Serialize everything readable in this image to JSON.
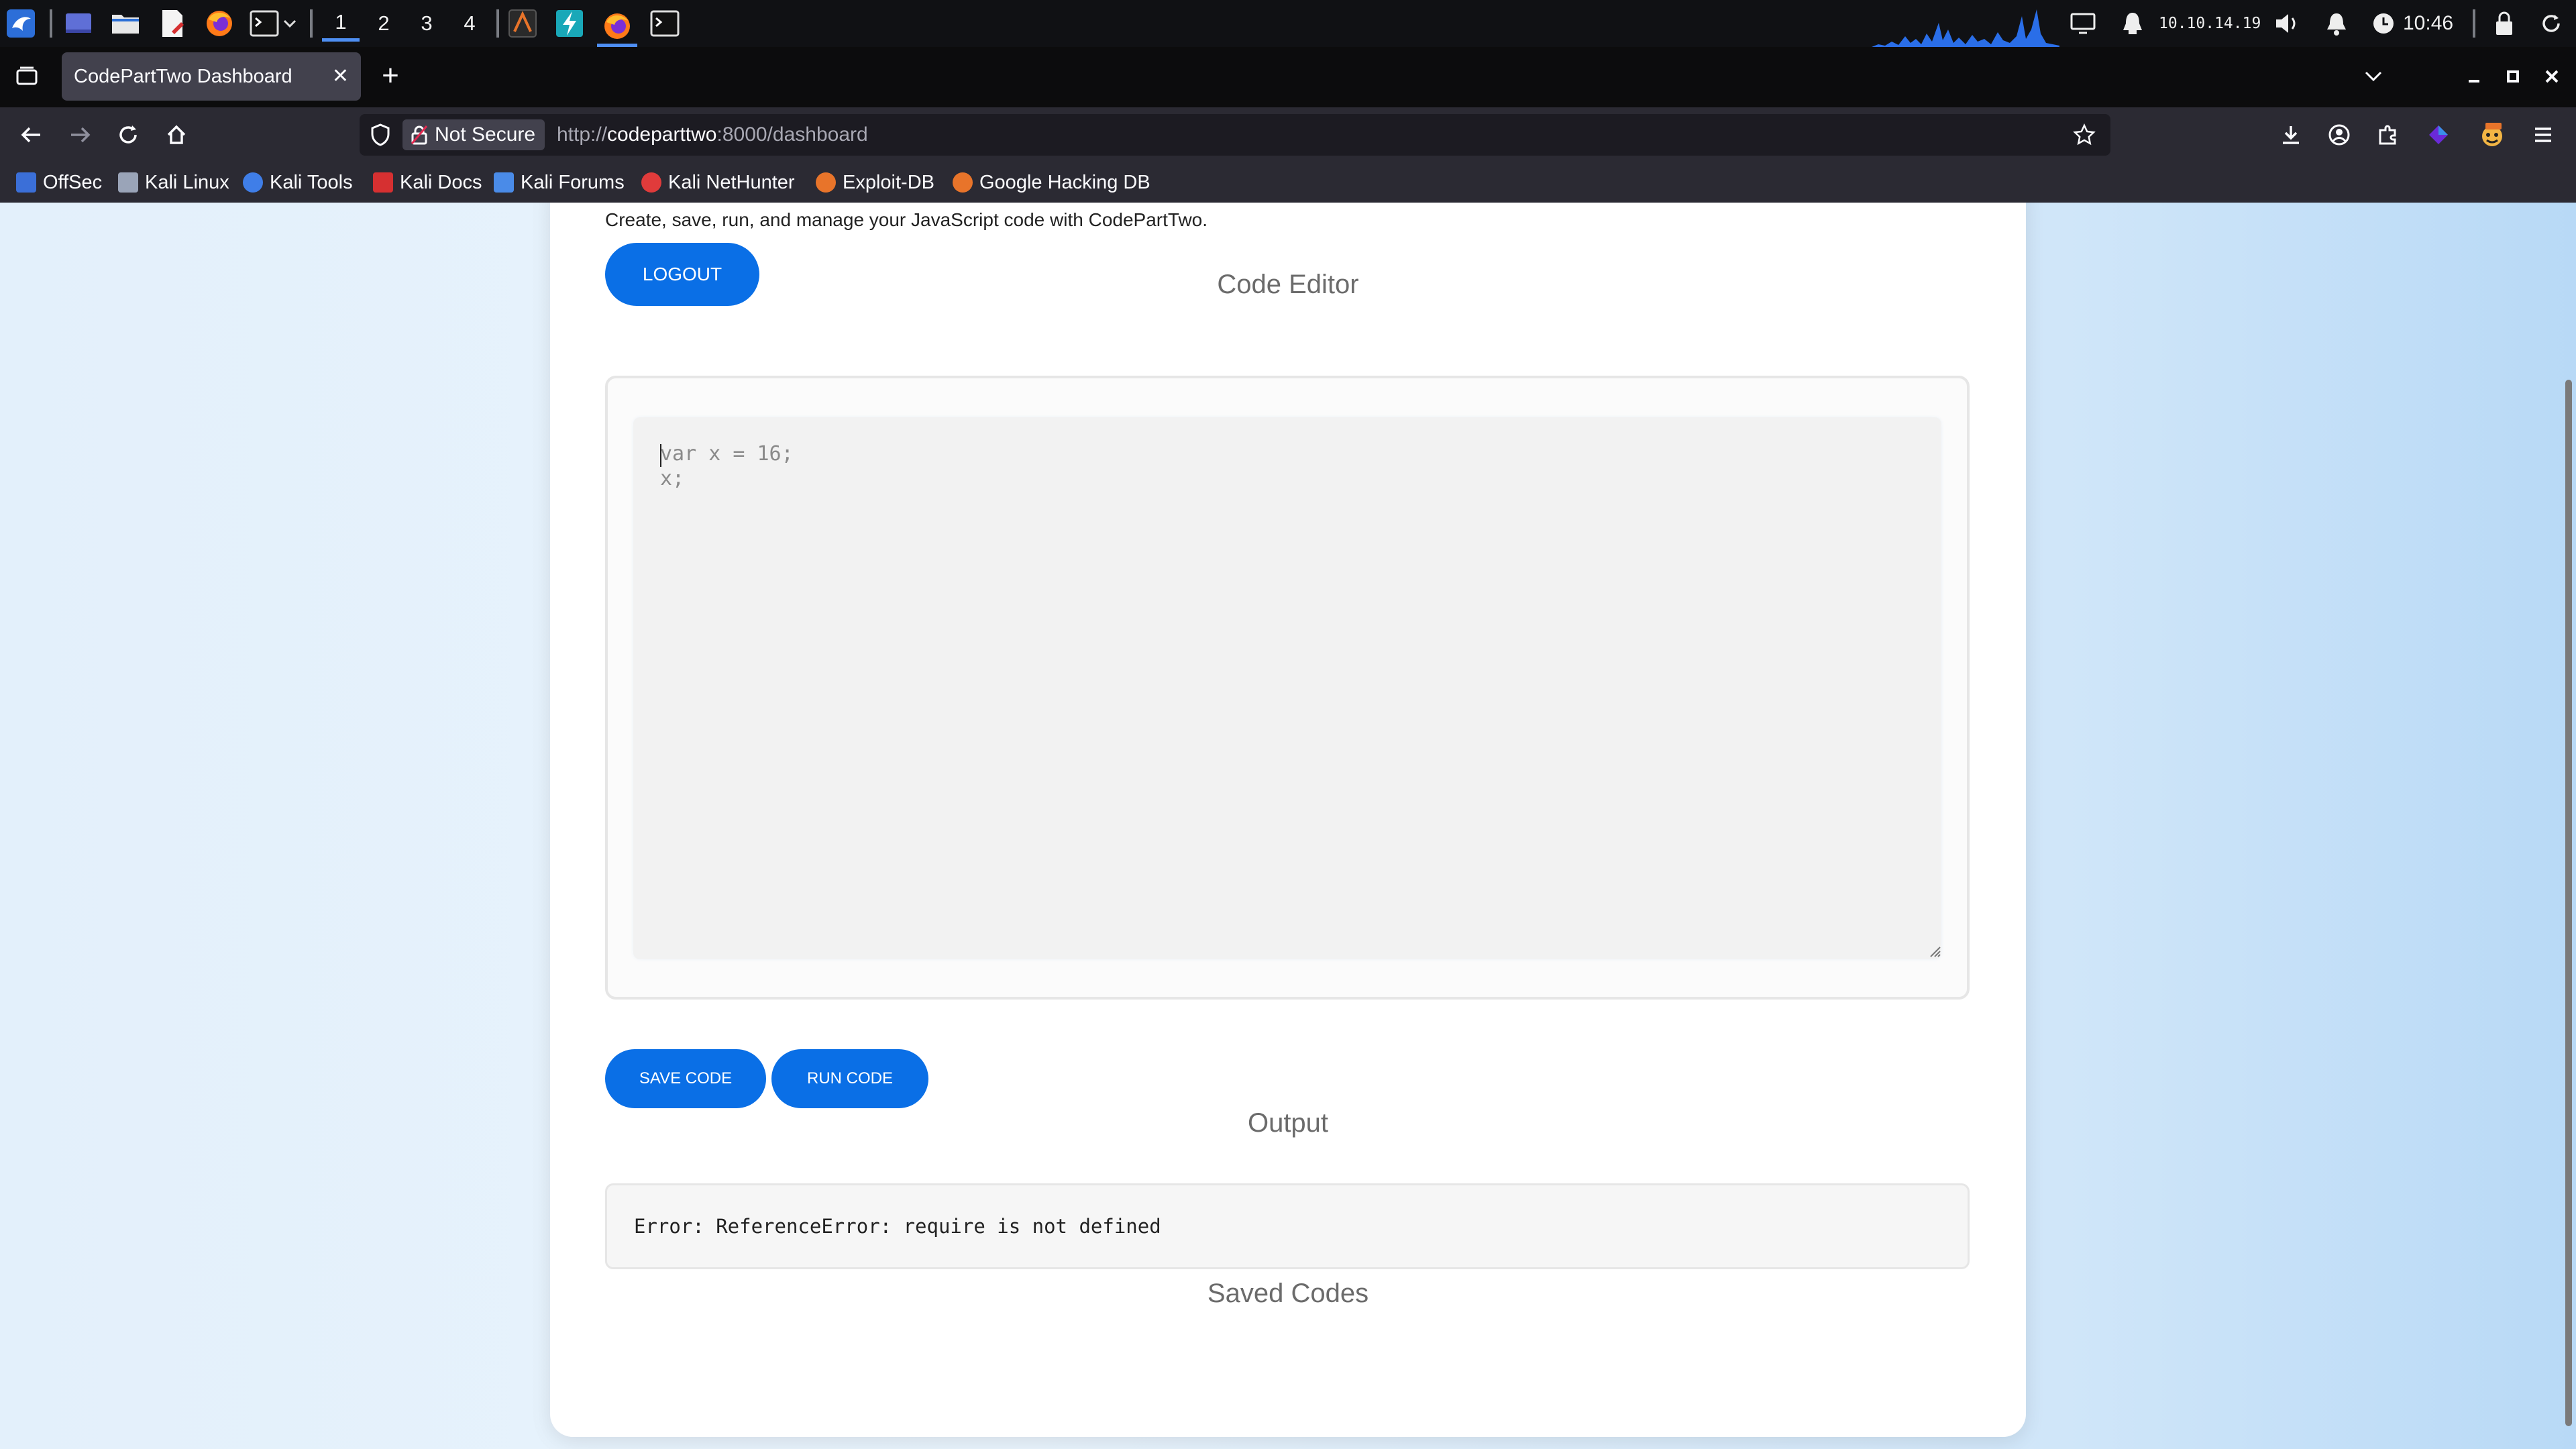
{
  "os_panel": {
    "workspaces": [
      "1",
      "2",
      "3",
      "4"
    ],
    "active_workspace": "1",
    "ip_address": "10.10.14.19",
    "clock": "10:46"
  },
  "browser": {
    "tab_title": "CodePartTwo Dashboard",
    "not_secure_label": "Not Secure",
    "url_scheme": "http://",
    "url_host": "codeparttwo",
    "url_rest": ":8000/dashboard",
    "bookmarks": [
      {
        "label": "OffSec",
        "icon": "offsec-icon",
        "color": "#3b6fd8"
      },
      {
        "label": "Kali Linux",
        "icon": "kali-dragon-icon",
        "color": "#9aa4b8"
      },
      {
        "label": "Kali Tools",
        "icon": "kali-tools-icon",
        "color": "#3f7ee8"
      },
      {
        "label": "Kali Docs",
        "icon": "kali-docs-icon",
        "color": "#d63031"
      },
      {
        "label": "Kali Forums",
        "icon": "kali-forums-icon",
        "color": "#4a8be8"
      },
      {
        "label": "Kali NetHunter",
        "icon": "nethunter-icon",
        "color": "#e03b3b"
      },
      {
        "label": "Exploit-DB",
        "icon": "exploit-db-icon",
        "color": "#e8742a"
      },
      {
        "label": "Google Hacking DB",
        "icon": "ghdb-icon",
        "color": "#e8742a"
      }
    ]
  },
  "page": {
    "subtitle": "Create, save, run, and manage your JavaScript code with CodePartTwo.",
    "logout_label": "LOGOUT",
    "editor_title": "Code Editor",
    "code": "var x = 16;\nx;",
    "save_label": "SAVE CODE",
    "run_label": "RUN CODE",
    "output_title": "Output",
    "output_text": "Error: ReferenceError: require is not defined",
    "saved_title": "Saved Codes"
  },
  "colors": {
    "accent": "#0a6fe6",
    "tab_active": "#42414d",
    "toolbar": "#2b2a33"
  }
}
